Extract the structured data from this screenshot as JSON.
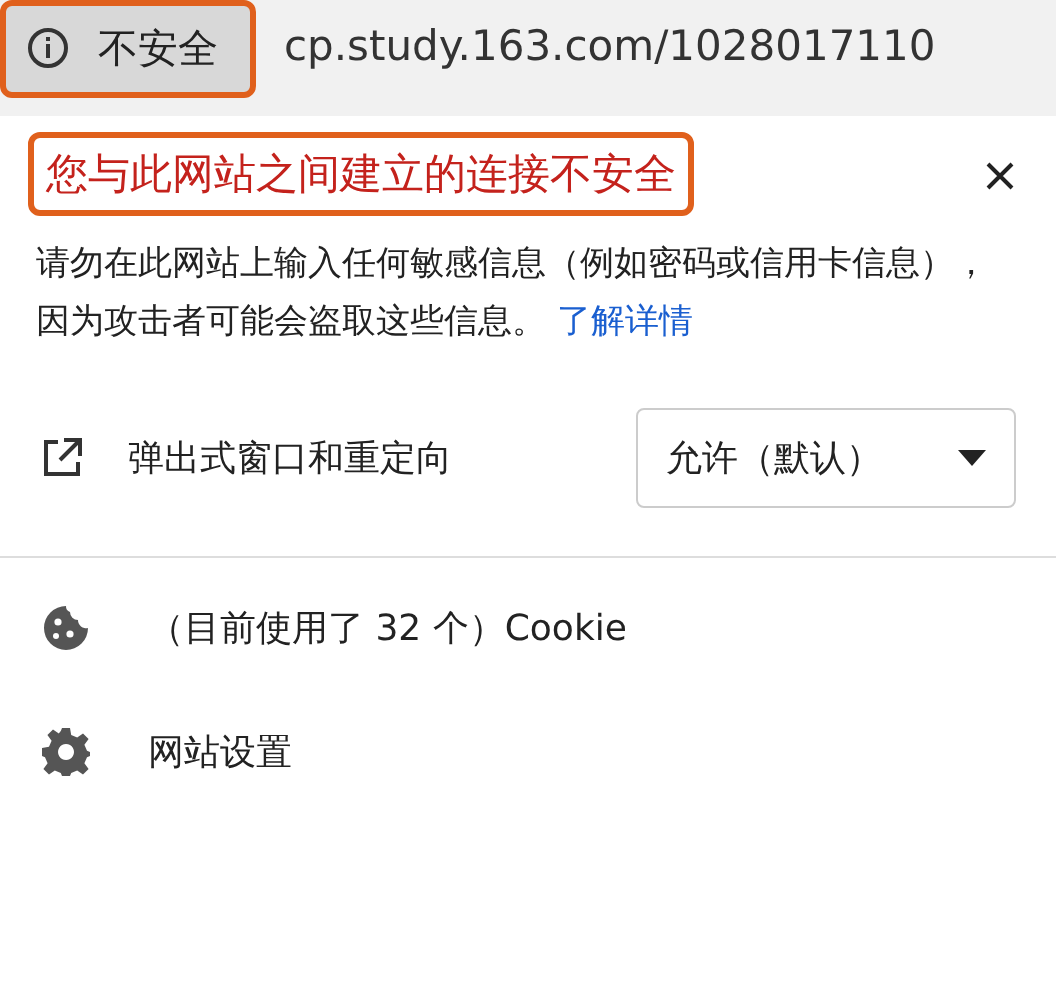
{
  "address_bar": {
    "security_label": "不安全",
    "url": "cp.study.163.com/1028017110"
  },
  "popup": {
    "title": "您与此网站之间建立的连接不安全",
    "description": "请勿在此网站上输入任何敏感信息（例如密码或信用卡信息），因为攻击者可能会盗取这些信息。",
    "link": "了解详情",
    "permissions": [
      {
        "label": "弹出式窗口和重定向",
        "value": "允许（默认）"
      }
    ],
    "items": [
      {
        "kind": "cookie",
        "label": "（目前使用了 32 个）Cookie"
      },
      {
        "kind": "settings",
        "label": "网站设置"
      }
    ]
  }
}
